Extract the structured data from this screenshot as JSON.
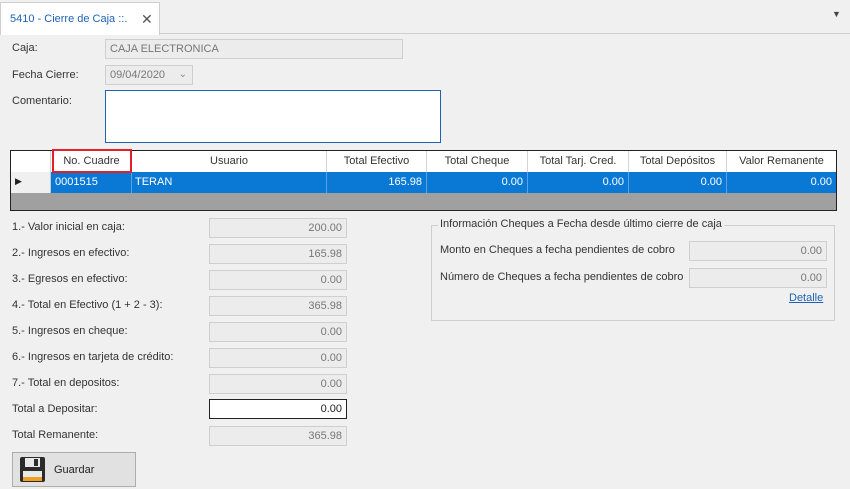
{
  "tab": {
    "title": "5410 - Cierre de Caja ::.",
    "close": "✕",
    "menu": "▼"
  },
  "form": {
    "caja_label": "Caja:",
    "caja_value": "CAJA ELECTRONICA",
    "fecha_label": "Fecha Cierre:",
    "fecha_value": "09/04/2020",
    "comentario_label": "Comentario:"
  },
  "grid": {
    "columns": [
      "No. Cuadre",
      "Usuario",
      "Total Efectivo",
      "Total Cheque",
      "Total Tarj. Cred.",
      "Total Depósitos",
      "Valor Remanente"
    ],
    "row": [
      "0001515",
      "TERAN",
      "165.98",
      "0.00",
      "0.00",
      "0.00",
      "0.00"
    ]
  },
  "summary": [
    {
      "label": "1.- Valor inicial en caja:",
      "value": "200.00"
    },
    {
      "label": "2.- Ingresos en efectivo:",
      "value": "165.98"
    },
    {
      "label": "3.- Egresos en efectivo:",
      "value": "0.00"
    },
    {
      "label": "4.- Total en Efectivo (1 + 2 - 3):",
      "value": "365.98"
    },
    {
      "label": "5.- Ingresos en cheque:",
      "value": "0.00"
    },
    {
      "label": "6.- Ingresos en tarjeta de crédito:",
      "value": "0.00"
    },
    {
      "label": "7.- Total en depositos:",
      "value": "0.00"
    },
    {
      "label": "Total a Depositar:",
      "value": "0.00"
    },
    {
      "label": "Total Remanente:",
      "value": "365.98"
    }
  ],
  "cheques": {
    "title": "Información Cheques a Fecha desde último cierre de caja",
    "monto_label": "Monto en Cheques a fecha pendientes de cobro",
    "monto_value": "0.00",
    "numero_label": "Número de Cheques a fecha pendientes de cobro",
    "numero_value": "0.00",
    "detalle": "Detalle"
  },
  "buttons": {
    "guardar": "Guardar"
  }
}
